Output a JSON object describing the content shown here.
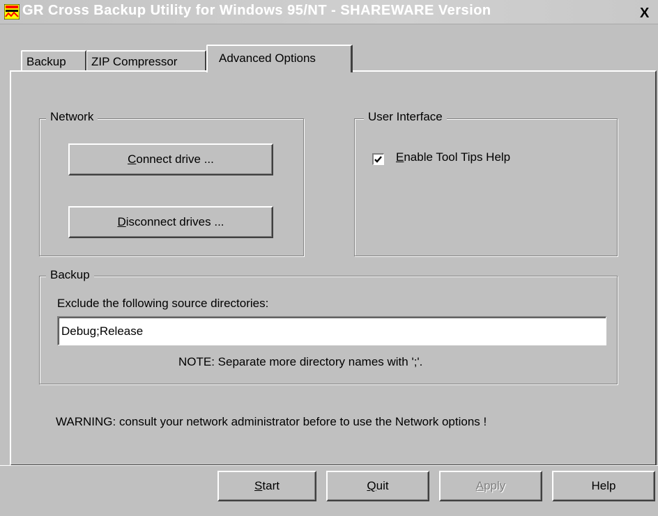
{
  "window": {
    "title": "GR Cross Backup Utility for Windows 95/NT - SHAREWARE Version",
    "close_glyph": "X"
  },
  "tabs": [
    {
      "label": "Backup",
      "selected": false
    },
    {
      "label": "ZIP Compressor",
      "selected": false
    },
    {
      "label": "Advanced Options",
      "selected": true
    }
  ],
  "network": {
    "legend": "Network",
    "connect": {
      "mnemonic": "C",
      "rest": "onnect drive ..."
    },
    "disconnect": {
      "mnemonic": "D",
      "rest": "isconnect drives ..."
    }
  },
  "user_interface": {
    "legend": "User Interface",
    "tooltips": {
      "mnemonic": "E",
      "rest": "nable Tool Tips Help",
      "checked": true
    }
  },
  "backup": {
    "legend": "Backup",
    "exclude_label": "Exclude the following source directories:",
    "exclude_value": "Debug;Release",
    "note": "NOTE: Separate more directory names with ';'."
  },
  "warning": "WARNING: consult your network administrator before to use the Network options !",
  "buttons": {
    "start": {
      "mnemonic": "S",
      "rest": "tart"
    },
    "quit": {
      "mnemonic": "Q",
      "rest": "uit"
    },
    "apply": {
      "mnemonic": "A",
      "rest": "pply",
      "enabled": false
    },
    "help": {
      "label": "Help"
    }
  },
  "colors": {
    "face": "#c0c0c0",
    "highlight": "#ffffff",
    "shadow": "#808080",
    "dark_shadow": "#404040",
    "disabled_text": "#808080",
    "icon_red": "#ff0000",
    "icon_yellow": "#ffff00"
  }
}
